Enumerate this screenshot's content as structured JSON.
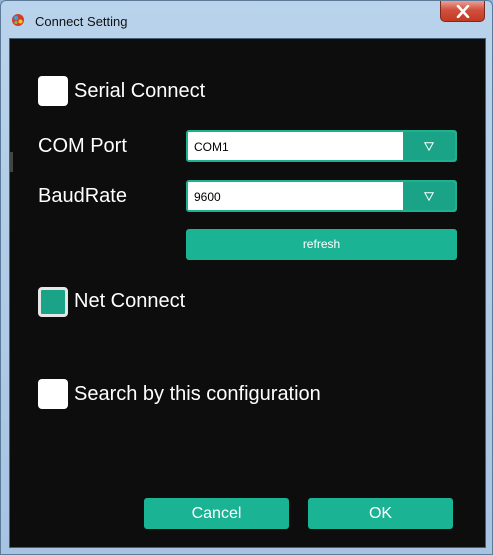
{
  "window": {
    "title": "Connect Setting"
  },
  "serial": {
    "label": "Serial Connect",
    "checked": false,
    "com_port_label": "COM Port",
    "com_port_value": "COM1",
    "baudrate_label": "BaudRate",
    "baudrate_value": "9600",
    "refresh_label": "refresh"
  },
  "net": {
    "label": "Net Connect",
    "checked": true
  },
  "search": {
    "label": "Search by this configuration",
    "checked": false
  },
  "footer": {
    "cancel_label": "Cancel",
    "ok_label": "OK"
  },
  "colors": {
    "accent": "#1ab394",
    "background": "#0d0d0d",
    "titlebar": "#a6c4e2",
    "close": "#c23a24"
  },
  "icons": {
    "app": "app-logo-icon",
    "close": "close-icon",
    "dropdown": "triangle-down-icon"
  }
}
